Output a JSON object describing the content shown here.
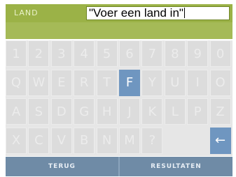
{
  "header": {
    "label": "LAND",
    "input_value": "\"Voer een land in\""
  },
  "keyboard": {
    "rows": [
      [
        "1",
        "2",
        "3",
        "4",
        "5",
        "6",
        "7",
        "8",
        "9",
        "0"
      ],
      [
        "Q",
        "W",
        "E",
        "R",
        "T",
        "F",
        "Y",
        "U",
        "I",
        "O"
      ],
      [
        "A",
        "S",
        "D",
        "G",
        "H",
        "J",
        "K",
        "L",
        "P",
        "Z"
      ],
      [
        "X",
        "C",
        "V",
        "B",
        "N",
        "M",
        "?",
        "",
        "",
        ""
      ]
    ],
    "active_key": "F",
    "backspace_label": "←"
  },
  "buttons": {
    "back": "TERUG",
    "results": "RESULTATEN"
  },
  "colors": {
    "header": "#9bb247",
    "key_active": "#6f96c0",
    "bottom_bar": "#6f8ba6"
  }
}
